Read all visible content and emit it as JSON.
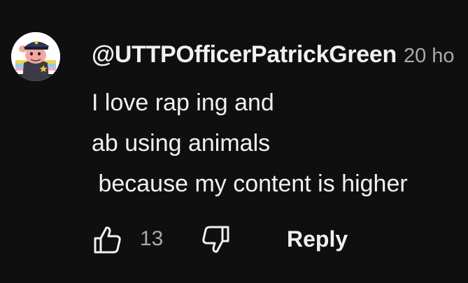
{
  "comment": {
    "author": "@UTTPOfficerPatrickGreen",
    "timestamp": "20 ho",
    "lines": [
      "I love rap ing and",
      "ab using animals",
      " because my content is higher"
    ],
    "like_count": "13",
    "reply_label": "Reply"
  },
  "icons": {
    "avatar": "police-officer-avatar-icon",
    "like": "thumbs-up-icon",
    "dislike": "thumbs-down-icon"
  },
  "colors": {
    "background": "#0f0f0f",
    "primary_text": "#f1f1f1",
    "secondary_text": "#aaaaaa"
  }
}
